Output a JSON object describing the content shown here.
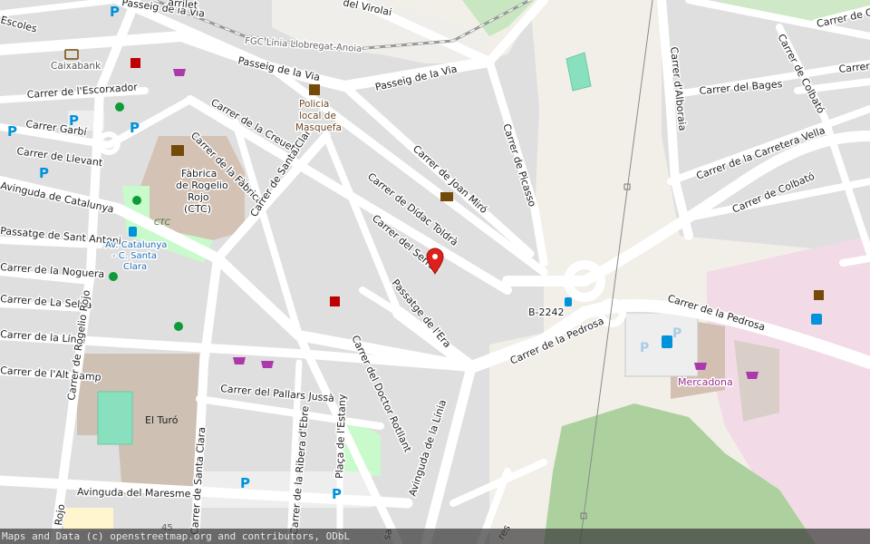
{
  "map": {
    "streets": {
      "passeig_via_top": "Passeig de la Via",
      "passeig_via_mid": "Passeig de la Via",
      "passeig_via_right": "Passeig de la Via",
      "virolai": "del Virolai",
      "escoles": "Escoles",
      "carrilet": "arrilet",
      "escorxador": "Carrer de l'Escorxador",
      "garbi": "Carrer Garbí",
      "llevant": "Carrer de Llevant",
      "catalunya": "Avinguda de Catalunya",
      "sant_antoni": "Passatge de Sant Antoni",
      "noguera": "Carrer de la Noguera",
      "selva": "Carrer de La Selva",
      "linia_left": "Carrer de la Línia",
      "alt_camp": "Carrer de l'Alt Camp",
      "rogelio_rojo": "Carrer de Rogelio Rojo",
      "rogelio_rojo_bottom": "Rojo",
      "maresme": "Avinguda del Maresme",
      "pallars": "Carrer del Pallars Jussà",
      "creueta": "Carrer de la Creueta",
      "fabrica": "Carrer de la Fàbrica",
      "santa_clara_top": "Carrer de Santa Clara",
      "santa_clara_bottom": "Carrer de Santa Clara",
      "joan_miro": "Carrer de Joan Miró",
      "didac": "Carrer de Dídac Toldrà",
      "serrat": "Carrer del Serrat",
      "era": "Passatge de l'Era",
      "doctor": "Carrer del Doctor Rotllant",
      "ribera": "Carrer de la Ribera d'Ebre",
      "estany": "Plaça de l'Estany",
      "linia_av": "Avinguda de la Línia",
      "picasso": "Carrer de Picasso",
      "alboraia": "Carrer d'Alboraia",
      "bages": "Carrer del Bages",
      "colbato_top": "Carrer de Colbató",
      "colbato_mid": "Carrer de Colbató",
      "carretera_vella": "Carrer de la Carretera Vella",
      "pedrosa_top": "Carrer de la Pedrosa",
      "pedrosa_bottom": "Carrer de la Pedrosa",
      "gui_top": "Carrer de Gui",
      "gui_right": "Carrer",
      "b2242": "B-2242",
      "bottom_cut": "sa",
      "bottom_cut2": "res",
      "number_45": "45"
    },
    "railway": "FGC Línia Llobregat-Anoia",
    "pois": {
      "caixabank": "Caixabank",
      "policia_1": "Policia",
      "policia_2": "local de",
      "policia_3": "Masquefa",
      "fabrica_1": "Fàbrica",
      "fabrica_2": "de Rogelio",
      "fabrica_3": "Rojo",
      "fabrica_4": "(CTC)",
      "ctc": "CTC",
      "bus_stop_1": "Av. Catalunya",
      "bus_stop_2": "- C. Santa",
      "bus_stop_3": "Clara",
      "el_turo": "El Turó",
      "mercadona": "Mercadona"
    },
    "colors": {
      "background": "#f2efe9",
      "residential": "#e0dfdf",
      "street": "#ffffff",
      "park": "#c8facc",
      "forest": "#add19e",
      "retail": "#ffd6d1",
      "commercial": "#f2dae7",
      "school": "#fff5cf",
      "parking": "#eeeeee",
      "pitch": "#88e0be",
      "railway": "#999999",
      "marker": "#e0201c",
      "parking_icon": "#0092da"
    },
    "icons": [
      "parking-icon",
      "bank-icon",
      "pharmacy-icon",
      "shop-icon",
      "police-icon",
      "museum-icon",
      "post-icon",
      "bus-stop-icon",
      "playground-icon",
      "fuel-icon",
      "charging-station-icon",
      "car-repair-icon",
      "location-marker-icon"
    ]
  },
  "attribution": "Maps and Data (c) openstreetmap.org and contributors, ODbL"
}
